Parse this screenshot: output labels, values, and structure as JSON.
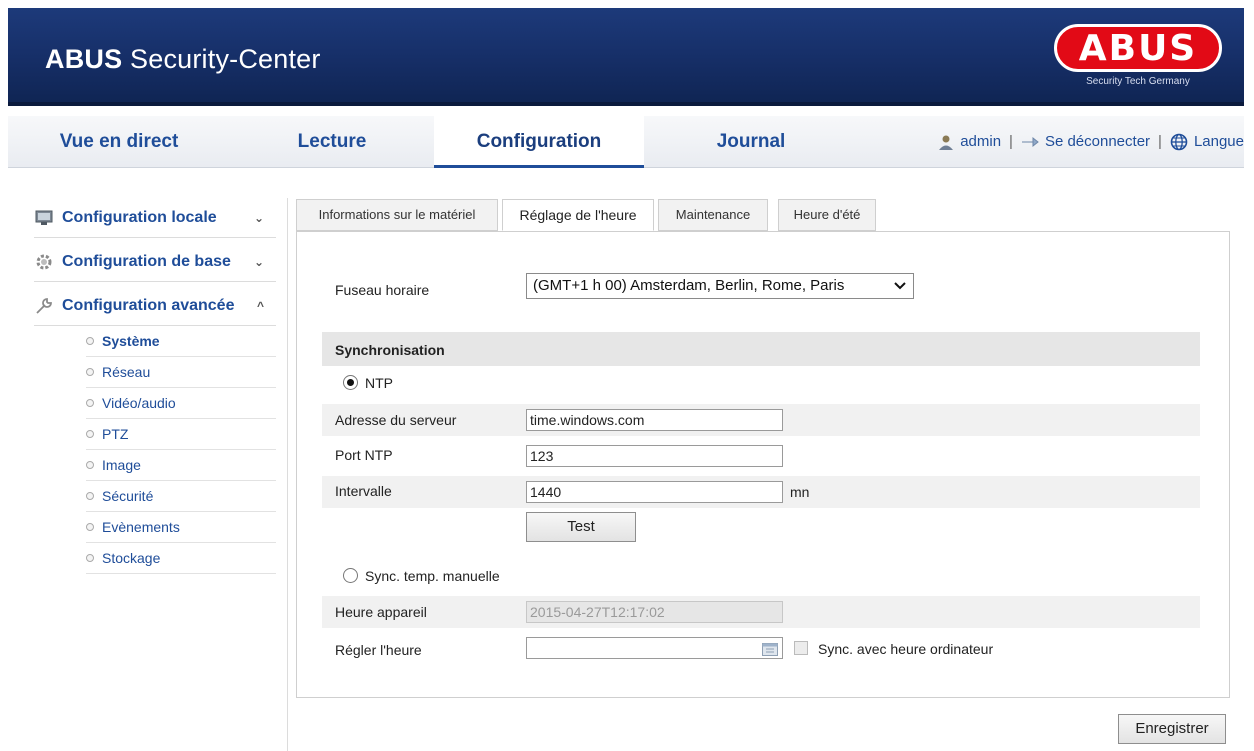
{
  "header": {
    "title_bold": "ABUS",
    "title_rest": " Security-Center",
    "logo_text": "ABUS",
    "logo_tagline": "Security Tech Germany"
  },
  "nav": {
    "items": [
      {
        "label": "Vue en direct"
      },
      {
        "label": "Lecture"
      },
      {
        "label": "Configuration"
      },
      {
        "label": "Journal"
      }
    ],
    "user": "admin",
    "logout": "Se déconnecter",
    "language": "Langue",
    "separator": "|"
  },
  "sidebar": {
    "sections": [
      {
        "label": "Configuration locale",
        "icon": "monitor-icon",
        "chevron": "⌄"
      },
      {
        "label": "Configuration de base",
        "icon": "gear-icon",
        "chevron": "⌄"
      },
      {
        "label": "Configuration avancée",
        "icon": "wrench-icon",
        "chevron": "^"
      }
    ],
    "items": [
      {
        "label": "Système"
      },
      {
        "label": "Réseau"
      },
      {
        "label": "Vidéo/audio"
      },
      {
        "label": "PTZ"
      },
      {
        "label": "Image"
      },
      {
        "label": "Sécurité"
      },
      {
        "label": "Evènements"
      },
      {
        "label": "Stockage"
      }
    ]
  },
  "tabs": [
    {
      "label": "Informations sur le matériel"
    },
    {
      "label": "Réglage de l'heure"
    },
    {
      "label": "Maintenance"
    },
    {
      "label": "Heure d'été"
    }
  ],
  "form": {
    "timezone_label": "Fuseau horaire",
    "timezone_value": "(GMT+1 h 00) Amsterdam, Berlin, Rome, Paris",
    "sync_title": "Synchronisation",
    "ntp_label": "NTP",
    "server_label": "Adresse du serveur",
    "server_value": "time.windows.com",
    "port_label": "Port NTP",
    "port_value": "123",
    "interval_label": "Intervalle",
    "interval_value": "1440",
    "interval_unit": "mn",
    "test_button": "Test",
    "manual_label": "Sync. temp. manuelle",
    "device_time_label": "Heure appareil",
    "device_time_value": "2015-04-27T12:17:02",
    "set_time_label": "Régler l'heure",
    "set_time_value": "",
    "sync_pc_label": "Sync. avec heure ordinateur"
  },
  "save_button": "Enregistrer",
  "colors": {
    "header_bg": "#17306a",
    "accent": "#1f4d99",
    "logo_red": "#e20a16"
  }
}
